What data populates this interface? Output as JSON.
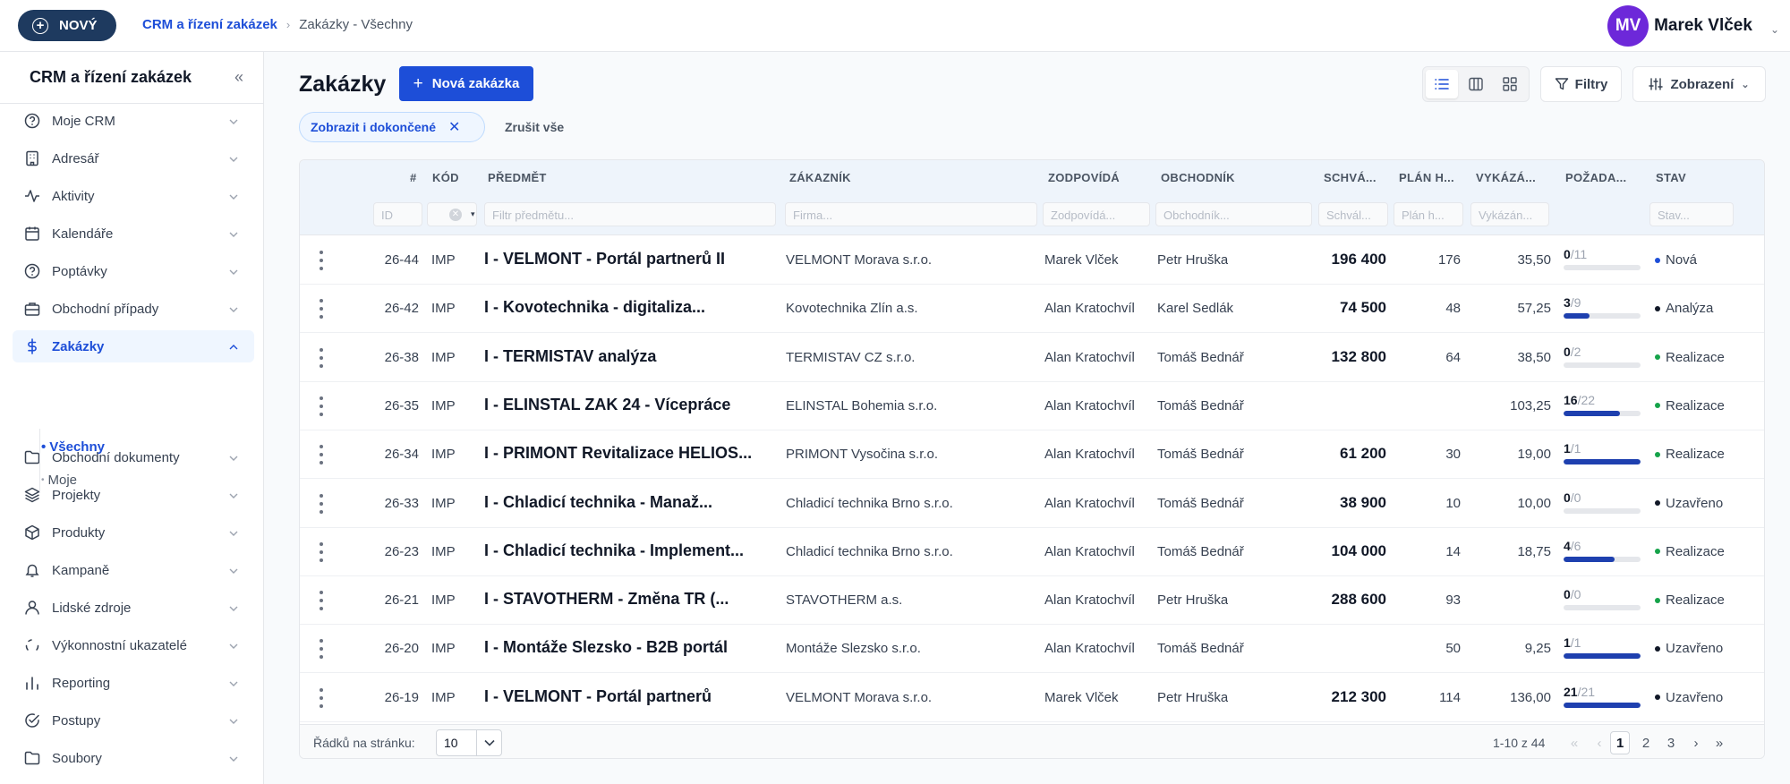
{
  "topbar": {
    "new_button_label": "NOVÝ",
    "breadcrumbs": [
      "CRM a řízení zakázek",
      "Zakázky - Všechny"
    ],
    "user": {
      "initials": "MV",
      "name": "Marek Vlček"
    }
  },
  "sidebar": {
    "title": "CRM a řízení zakázek",
    "items": [
      {
        "label": "Moje CRM",
        "icon": "help-circle-icon"
      },
      {
        "label": "Adresář",
        "icon": "building-icon"
      },
      {
        "label": "Aktivity",
        "icon": "activity-icon"
      },
      {
        "label": "Kalendáře",
        "icon": "calendar-icon"
      },
      {
        "label": "Poptávky",
        "icon": "help-circle-icon"
      },
      {
        "label": "Obchodní případy",
        "icon": "briefcase-icon"
      },
      {
        "label": "Zakázky",
        "icon": "dollar-icon"
      },
      {
        "label": "Obchodní dokumenty",
        "icon": "folder-icon"
      },
      {
        "label": "Projekty",
        "icon": "layers-icon"
      },
      {
        "label": "Produkty",
        "icon": "package-icon"
      },
      {
        "label": "Kampaně",
        "icon": "bell-icon"
      },
      {
        "label": "Lidské zdroje",
        "icon": "user-icon"
      },
      {
        "label": "Výkonnostní ukazatelé",
        "icon": "gauge-icon"
      },
      {
        "label": "Reporting",
        "icon": "bar-chart-icon"
      },
      {
        "label": "Postupy",
        "icon": "check-circle-icon"
      },
      {
        "label": "Soubory",
        "icon": "folder-icon"
      }
    ],
    "subitems": [
      "Všechny",
      "Moje"
    ]
  },
  "main": {
    "title": "Zakázky",
    "add_button_label": "Nová zakázka",
    "filter_button_label": "Filtry",
    "view_button_label": "Zobrazení",
    "chip_label": "Zobrazit i dokončené",
    "clear_all_label": "Zrušit vše"
  },
  "table": {
    "headers": [
      "#",
      "KÓD",
      "PŘEDMĚT",
      "ZÁKAZNÍK",
      "ZODPOVÍDÁ",
      "OBCHODNÍK",
      "SCHVÁ...",
      "PLÁN H...",
      "VYKÁZÁ...",
      "POŽADA...",
      "STAV"
    ],
    "filter_placeholders": {
      "id": "ID",
      "subject": "Filtr předmětu...",
      "customer": "Firma...",
      "responsible": "Zodpovídá...",
      "salesperson": "Obchodník...",
      "approved": "Schvál...",
      "planned": "Plán h...",
      "reported": "Vykázán...",
      "status": "Stav..."
    },
    "rows": [
      {
        "id": "26-44",
        "code": "IMP",
        "subject": "I - VELMONT - Portál partnerů II",
        "customer": "VELMONT Morava s.r.o.",
        "responsible": "Marek Vlček",
        "salesperson": "Petr Hruška",
        "approved": "196 400",
        "planned": "176",
        "reported": "35,50",
        "req_done": "0",
        "req_total": "/11",
        "req_ratio": 0,
        "status": "Nová",
        "status_color": "#1d4ed8"
      },
      {
        "id": "26-42",
        "code": "IMP",
        "subject": "I - Kovotechnika - digitaliza...",
        "customer": "Kovotechnika Zlín a.s.",
        "responsible": "Alan Kratochvíl",
        "salesperson": "Karel Sedlák",
        "approved": "74 500",
        "planned": "48",
        "reported": "57,25",
        "req_done": "3",
        "req_total": "/9",
        "req_ratio": 0.333,
        "status": "Analýza",
        "status_color": "#111827"
      },
      {
        "id": "26-38",
        "code": "IMP",
        "subject": "I - TERMISTAV analýza",
        "customer": "TERMISTAV CZ s.r.o.",
        "responsible": "Alan Kratochvíl",
        "salesperson": "Tomáš Bednář",
        "approved": "132 800",
        "planned": "64",
        "reported": "38,50",
        "req_done": "0",
        "req_total": "/2",
        "req_ratio": 0,
        "status": "Realizace",
        "status_color": "#16a34a"
      },
      {
        "id": "26-35",
        "code": "IMP",
        "subject": "I - ELINSTAL ZAK 24 - Vícepráce",
        "customer": "ELINSTAL Bohemia s.r.o.",
        "responsible": "Alan Kratochvíl",
        "salesperson": "Tomáš Bednář",
        "approved": "",
        "planned": "",
        "reported": "103,25",
        "req_done": "16",
        "req_total": "/22",
        "req_ratio": 0.727,
        "status": "Realizace",
        "status_color": "#16a34a"
      },
      {
        "id": "26-34",
        "code": "IMP",
        "subject": "I - PRIMONT Revitalizace HELIOS...",
        "customer": "PRIMONT Vysočina s.r.o.",
        "responsible": "Alan Kratochvíl",
        "salesperson": "Tomáš Bednář",
        "approved": "61 200",
        "planned": "30",
        "reported": "19,00",
        "req_done": "1",
        "req_total": "/1",
        "req_ratio": 1,
        "status": "Realizace",
        "status_color": "#16a34a"
      },
      {
        "id": "26-33",
        "code": "IMP",
        "subject": "I - Chladicí technika - Manaž...",
        "customer": "Chladicí technika Brno s.r.o.",
        "responsible": "Alan Kratochvíl",
        "salesperson": "Tomáš Bednář",
        "approved": "38 900",
        "planned": "10",
        "reported": "10,00",
        "req_done": "0",
        "req_total": "/0",
        "req_ratio": 0,
        "status": "Uzavřeno",
        "status_color": "#111827"
      },
      {
        "id": "26-23",
        "code": "IMP",
        "subject": "I - Chladicí technika - Implement...",
        "customer": "Chladicí technika Brno s.r.o.",
        "responsible": "Alan Kratochvíl",
        "salesperson": "Tomáš Bednář",
        "approved": "104 000",
        "planned": "14",
        "reported": "18,75",
        "req_done": "4",
        "req_total": "/6",
        "req_ratio": 0.667,
        "status": "Realizace",
        "status_color": "#16a34a"
      },
      {
        "id": "26-21",
        "code": "IMP",
        "subject": "I - STAVOTHERM - Změna TR (...",
        "customer": "STAVOTHERM a.s.",
        "responsible": "Alan Kratochvíl",
        "salesperson": "Petr Hruška",
        "approved": "288 600",
        "planned": "93",
        "reported": "",
        "req_done": "0",
        "req_total": "/0",
        "req_ratio": 0,
        "status": "Realizace",
        "status_color": "#16a34a"
      },
      {
        "id": "26-20",
        "code": "IMP",
        "subject": "I - Montáže Slezsko - B2B portál",
        "customer": "Montáže Slezsko s.r.o.",
        "responsible": "Alan Kratochvíl",
        "salesperson": "Tomáš Bednář",
        "approved": "",
        "planned": "50",
        "reported": "9,25",
        "req_done": "1",
        "req_total": "/1",
        "req_ratio": 1,
        "status": "Uzavřeno",
        "status_color": "#111827"
      },
      {
        "id": "26-19",
        "code": "IMP",
        "subject": "I - VELMONT - Portál partnerů",
        "customer": "VELMONT Morava s.r.o.",
        "responsible": "Marek Vlček",
        "salesperson": "Petr Hruška",
        "approved": "212 300",
        "planned": "114",
        "reported": "136,00",
        "req_done": "21",
        "req_total": "/21",
        "req_ratio": 1,
        "status": "Uzavřeno",
        "status_color": "#111827"
      }
    ],
    "footer": {
      "rows_per_page_label": "Řádků na stránku:",
      "rows_per_page_value": "10",
      "range_text": "1-10 z 44",
      "pages": [
        "1",
        "2",
        "3"
      ]
    }
  }
}
